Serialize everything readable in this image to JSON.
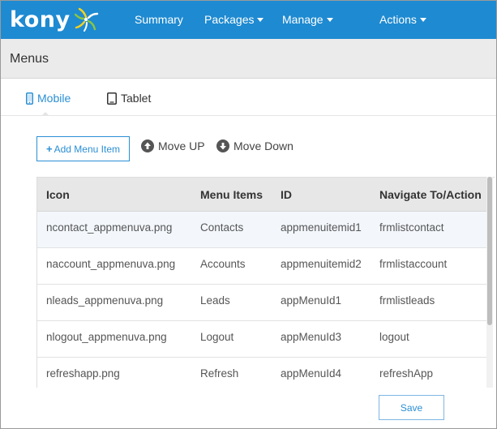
{
  "brand": {
    "name": "kony",
    "accent": "#1e8ad1"
  },
  "nav": {
    "summary": "Summary",
    "packages": "Packages",
    "manage": "Manage",
    "actions": "Actions"
  },
  "page": {
    "title": "Menus"
  },
  "tabs": {
    "mobile": {
      "label": "Mobile",
      "icon": "mobile-icon",
      "active": true
    },
    "tablet": {
      "label": "Tablet",
      "icon": "tablet-icon",
      "active": false
    }
  },
  "toolbar": {
    "add_label": "Add Menu Item",
    "move_up_label": "Move UP",
    "move_down_label": "Move Down"
  },
  "table": {
    "headers": [
      "Icon",
      "Menu Items",
      "ID",
      "Navigate To/Action"
    ],
    "rows": [
      [
        "ncontact_appmenuva.png",
        "Contacts",
        "appmenuitemid1",
        "frmlistcontact"
      ],
      [
        "naccount_appmenuva.png",
        "Accounts",
        "appmenuitemid2",
        "frmlistaccount"
      ],
      [
        "nleads_appmenuva.png",
        "Leads",
        "appMenuId1",
        "frmlistleads"
      ],
      [
        "nlogout_appmenuva.png",
        "Logout",
        "appMenuId3",
        "logout"
      ],
      [
        "refreshapp.png",
        "Refresh",
        "appMenuId4",
        "refreshApp"
      ]
    ]
  },
  "footer": {
    "save_label": "Save"
  }
}
